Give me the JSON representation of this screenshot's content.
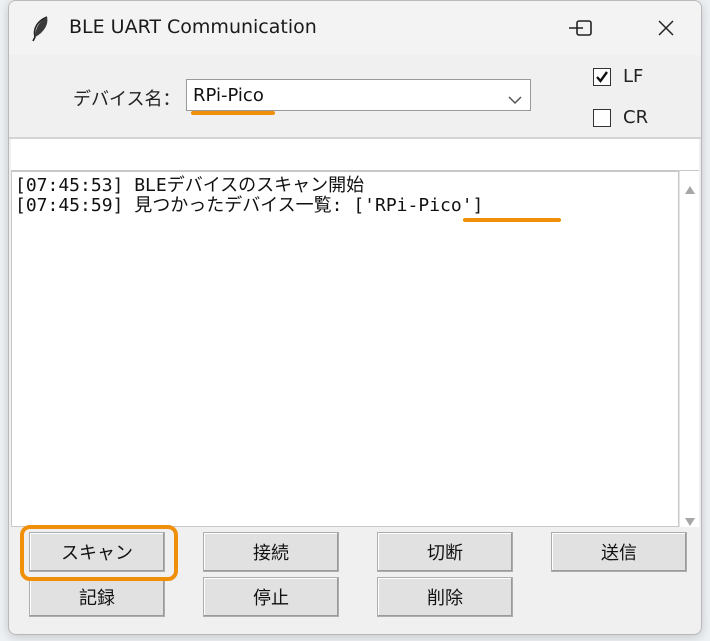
{
  "window": {
    "title": "BLE UART Communication",
    "icon": "feather-icon",
    "controls": [
      "minimize-icon",
      "maximize-icon",
      "close-icon"
    ]
  },
  "device": {
    "label": "デバイス名：",
    "selected": "RPi-Pico"
  },
  "options": {
    "lf": {
      "label": "LF",
      "checked": true
    },
    "cr": {
      "label": "CR",
      "checked": false
    }
  },
  "send_entry": {
    "value": ""
  },
  "log": {
    "lines": [
      "[07:45:53] BLEデバイスのスキャン開始",
      "[07:45:59] 見つかったデバイス一覧: ['RPi-Pico']"
    ]
  },
  "buttons": {
    "scan": "スキャン",
    "connect": "接続",
    "disconnect": "切断",
    "send": "送信",
    "record": "記録",
    "stop": "停止",
    "delete": "削除"
  },
  "colors": {
    "highlight": "#f0900a",
    "window_bg": "#f0f0f0",
    "button_bg": "#e1e1e1"
  }
}
